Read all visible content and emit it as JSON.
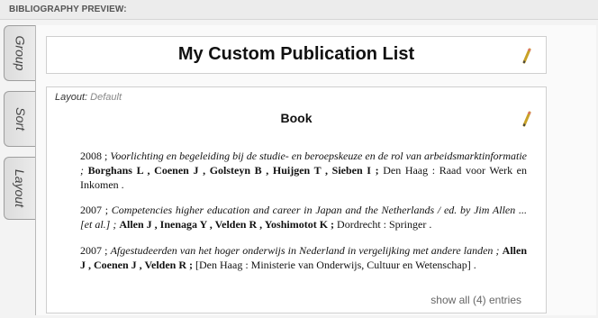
{
  "header": {
    "title": "BIBLIOGRAPHY PREVIEW:"
  },
  "tabs": [
    {
      "label": "Group"
    },
    {
      "label": "Sort"
    },
    {
      "label": "Layout"
    }
  ],
  "publication_list": {
    "title": "My Custom Publication List"
  },
  "layout": {
    "label": "Layout:",
    "value": "Default"
  },
  "section": {
    "heading": "Book"
  },
  "entries": [
    {
      "year": "2008",
      "sep1": " ; ",
      "title": "Voorlichting en begeleiding bij de studie- en beroepskeuze en de rol van arbeidsmarktinformatie",
      "sep2": " ; ",
      "authors": "Borghans L , Coenen J , Golsteyn B , Huijgen T , Sieben I ;",
      "publisher": "Den Haag : Raad voor Werk en Inkomen",
      "end": " ."
    },
    {
      "year": "2007",
      "sep1": " ; ",
      "title": "Competencies higher education and career in Japan and the Netherlands / ed. by Jim Allen ... [et al.]",
      "sep2": " ; ",
      "authors": "Allen J , Inenaga Y , Velden R , Yoshimotot K ;",
      "publisher": "Dordrecht : Springer",
      "end": " ."
    },
    {
      "year": "2007",
      "sep1": " ; ",
      "title": "Afgestudeerden van het hoger onderwijs in Nederland in vergelijking met andere landen",
      "sep2": " ; ",
      "authors": "Allen J , Coenen J , Velden R ;",
      "publisher": "[Den Haag : Ministerie van Onderwijs, Cultuur en Wetenschap]",
      "end": " ."
    }
  ],
  "show_all": {
    "label": "show all (4) entries"
  },
  "icons": {
    "edit": "pencil-icon"
  },
  "colors": {
    "header_bg": "#ececec",
    "tab_border": "#9e9e9e",
    "pencil": "#c9a227"
  }
}
